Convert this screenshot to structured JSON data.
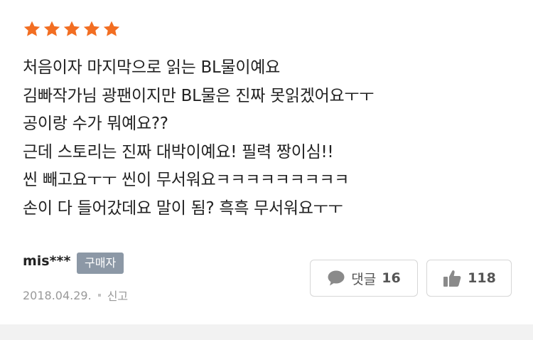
{
  "colors": {
    "star": "#f26e22",
    "badge_bg": "#8c98a6",
    "muted": "#999999"
  },
  "rating": {
    "stars": 5,
    "max": 5
  },
  "review": {
    "lines": [
      "처음이자 마지막으로 읽는 BL물이예요",
      "김빠작가님 광팬이지만 BL물은 진짜 못읽겠어요ㅜㅜ",
      "공이랑 수가 뭐예요??",
      "근데 스토리는 진짜 대박이예요! 필력 짱이심!!",
      "씬 빼고요ㅜㅜ 씬이 무서워요ㅋㅋㅋㅋㅋㅋㅋㅋㅋ",
      "손이 다 들어갔데요 말이 됨? 흑흑 무서워요ㅜㅜ"
    ],
    "author": "mis***",
    "buyer_badge": "구매자",
    "date": "2018.04.29.",
    "report_label": "신고"
  },
  "actions": {
    "comment_label": "댓글",
    "comment_count": "16",
    "like_count": "118",
    "comment_icon": "speech-bubble-icon",
    "like_icon": "thumbs-up-icon"
  }
}
